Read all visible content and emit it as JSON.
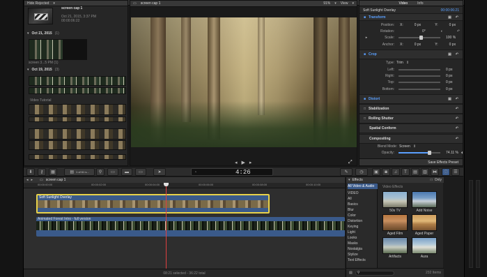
{
  "browser": {
    "filter_label": "Hide Rejected",
    "top_clip": {
      "name": "screen cap 1",
      "date": "Oct 21, 2015, 3:37 PM",
      "duration": "00:00:06:22"
    },
    "groups": [
      {
        "date": "Oct 21, 2015",
        "count": "(1)"
      },
      {
        "date": "Oct 19, 2015",
        "count": "(3)"
      }
    ],
    "clip_small_label": "screen 3...5 PM (1)",
    "clip_video_tutorial": "Video Tutorial"
  },
  "viewer": {
    "title": "screen cap 1",
    "zoom": "91%",
    "view_label": "View",
    "timecode_display": "4:26"
  },
  "inspector": {
    "tabs": [
      "Video",
      "Info"
    ],
    "effect_name": "Soft Sunlight Overlay",
    "duration": "00:00:06:21",
    "sections": [
      {
        "title": "Transform"
      },
      {
        "title": "Crop"
      },
      {
        "title": "Distort"
      },
      {
        "title": "Stabilization"
      },
      {
        "title": "Rolling Shutter"
      },
      {
        "title": "Spatial Conform"
      },
      {
        "title": "Compositing"
      }
    ],
    "transform": {
      "position": {
        "label": "Position:",
        "x_label": "X:",
        "x_value": "0 px",
        "y_label": "Y:",
        "y_value": "0 px"
      },
      "rotation": {
        "label": "Rotation:",
        "value": "0°"
      },
      "scale": {
        "label": "Scale:",
        "value": "100 %"
      },
      "anchor": {
        "label": "Anchor:",
        "x_label": "X:",
        "x_value": "0 px",
        "y_label": "Y:",
        "y_value": "0 px"
      }
    },
    "crop": {
      "type": {
        "label": "Type:",
        "value": "Trim"
      },
      "left": {
        "label": "Left:",
        "value": "0 px"
      },
      "right": {
        "label": "Right:",
        "value": "0 px"
      },
      "top": {
        "label": "Top:",
        "value": "0 px"
      },
      "bottom": {
        "label": "Bottom:",
        "value": "0 px"
      }
    },
    "compositing": {
      "blend_mode": {
        "label": "Blend Mode:",
        "value": "Screen"
      },
      "opacity": {
        "label": "Opacity:",
        "value": "74.11 %",
        "level": 0.74
      }
    },
    "save_preset": "Save Effects Preset"
  },
  "toolbar": {
    "clip_index": "1 of 61 s..."
  },
  "timeline": {
    "title": "screen cap 1",
    "ruler": [
      "00:00:00:00",
      "00:00:02:00",
      "00:00:04:00",
      "00:00:06:00",
      "00:00:08:00",
      "00:00:10:00",
      "00:00:12:00"
    ],
    "upper_clip": "Soft Sunlight Overlay",
    "lower_clip": "Animated Forest Intro - full version",
    "status": "08:21 selected - 36:22 total"
  },
  "effects": {
    "title": "Effects",
    "only_label": "Only",
    "active_category": "All Video & Audio",
    "section_header": "Video Effects",
    "section_label": "VIDEO",
    "categories": [
      "All",
      "Basics",
      "Blur",
      "Color",
      "Distortion",
      "Keying",
      "Light",
      "Looks",
      "Masks",
      "Nostalgia",
      "Stylize",
      "Text Effects"
    ],
    "items": [
      "50s TV",
      "Add Noise",
      "Aged Film",
      "Aged Paper",
      "Artifacts",
      "Aura"
    ],
    "count": "232 Items"
  }
}
